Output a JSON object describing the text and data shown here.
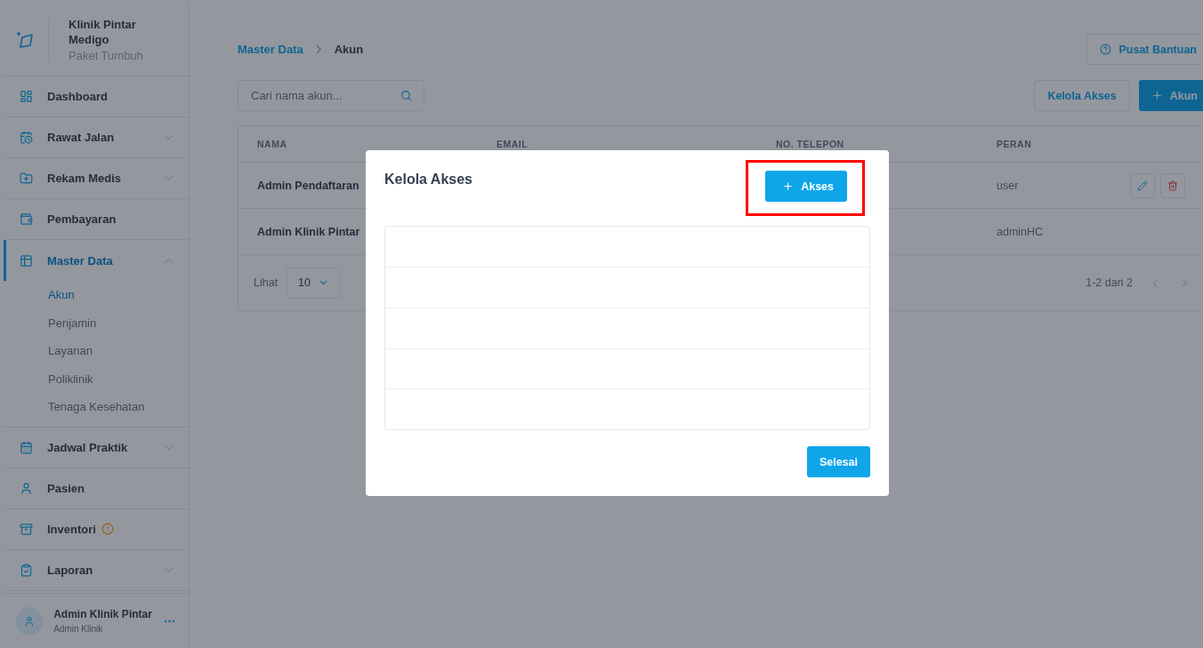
{
  "sidebar": {
    "brand": {
      "name": "Klinik Pintar Medigo",
      "plan": "Paket Tumbuh"
    },
    "items": [
      {
        "label": "Dashboard",
        "kind": "link",
        "selected": false
      },
      {
        "label": "Rawat Jalan",
        "kind": "group",
        "expanded": false,
        "selected": false
      },
      {
        "label": "Rekam Medis",
        "kind": "group",
        "expanded": false,
        "selected": false
      },
      {
        "label": "Pembayaran",
        "kind": "link",
        "selected": false
      },
      {
        "label": "Master Data",
        "kind": "group",
        "expanded": true,
        "selected": true,
        "children": [
          {
            "label": "Akun",
            "selected": true
          },
          {
            "label": "Penjamin",
            "selected": false
          },
          {
            "label": "Layanan",
            "selected": false
          },
          {
            "label": "Poliklinik",
            "selected": false
          },
          {
            "label": "Tenaga Kesehatan",
            "selected": false
          }
        ]
      },
      {
        "label": "Jadwal Praktik",
        "kind": "group",
        "expanded": false,
        "selected": false
      },
      {
        "label": "Pasien",
        "kind": "link",
        "selected": false
      },
      {
        "label": "Inventori",
        "kind": "link",
        "selected": false,
        "alert": true
      },
      {
        "label": "Laporan",
        "kind": "group",
        "expanded": false,
        "selected": false
      }
    ],
    "user": {
      "name": "Admin Klinik Pintar",
      "role": "Admin Klinik"
    }
  },
  "breadcrumb": [
    "Master Data",
    "Akun"
  ],
  "help_button": "Pusat Bantuan",
  "search": {
    "placeholder": "Cari nama akun..."
  },
  "buttons": [
    "Kelola Akses",
    "Akun"
  ],
  "table": {
    "columns": [
      "NAMA",
      "EMAIL",
      "NO. TELEPON",
      "PERAN"
    ],
    "rows": [
      {
        "cells": [
          "Admin Pendaftaran",
          "",
          "",
          "user"
        ],
        "actions": true
      },
      {
        "cells": [
          "Admin Klinik Pintar",
          "",
          "",
          "adminHC"
        ],
        "actions": false
      }
    ]
  },
  "pagination": {
    "label": "Lihat",
    "page_size": "10",
    "range": "1-2 dari 2"
  },
  "modal": {
    "title": "Kelola Akses",
    "add_button": {
      "label": "Akses",
      "highlighted": true
    },
    "done_button": "Selesai"
  }
}
